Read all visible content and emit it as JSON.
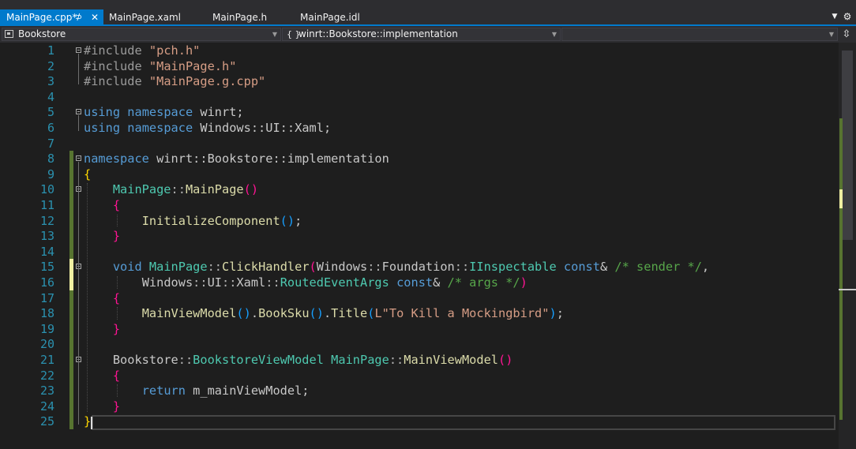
{
  "tabs": [
    {
      "label": "MainPage.cpp*",
      "active": true,
      "pinned": true,
      "closable": true
    },
    {
      "label": "MainPage.xaml",
      "active": false
    },
    {
      "label": "MainPage.h",
      "active": false
    },
    {
      "label": "MainPage.idl",
      "active": false
    }
  ],
  "tab_icons": {
    "pin": "pin-icon",
    "close": "close-icon",
    "overflow": "chevron-down-icon",
    "settings": "gear-icon"
  },
  "navigation": {
    "project": "Bookstore",
    "scope": "winrt::Bookstore::implementation",
    "member": "",
    "scope_icon": "{ }",
    "split_icon": "split-view-icon"
  },
  "colors": {
    "accent": "#007acc",
    "editor_background": "#1e1e1e",
    "line_number": "#2b91af",
    "keyword": "#569cd6",
    "string": "#d69d85",
    "comment": "#57a64a",
    "type": "#4ec9b0",
    "function": "#dcdcaa",
    "saved_change": "#577430",
    "unsaved_change": "#efefa1"
  },
  "code_lines": [
    {
      "num": "1"
    },
    {
      "num": "2"
    },
    {
      "num": "3"
    },
    {
      "num": "4"
    },
    {
      "num": "5"
    },
    {
      "num": "6"
    },
    {
      "num": "7"
    },
    {
      "num": "8"
    },
    {
      "num": "9"
    },
    {
      "num": "10"
    },
    {
      "num": "11"
    },
    {
      "num": "12"
    },
    {
      "num": "13"
    },
    {
      "num": "14"
    },
    {
      "num": "15"
    },
    {
      "num": "16"
    },
    {
      "num": "17"
    },
    {
      "num": "18"
    },
    {
      "num": "19"
    },
    {
      "num": "20"
    },
    {
      "num": "21"
    },
    {
      "num": "22"
    },
    {
      "num": "23"
    },
    {
      "num": "24"
    },
    {
      "num": "25"
    }
  ],
  "code": {
    "l1": [
      {
        "t": "#include",
        "c": "pp"
      },
      {
        "t": " ",
        "c": ""
      },
      {
        "t": "\"pch.h\"",
        "c": "str"
      }
    ],
    "l2": [
      {
        "t": "#include",
        "c": "pp"
      },
      {
        "t": " ",
        "c": ""
      },
      {
        "t": "\"MainPage.h\"",
        "c": "str"
      }
    ],
    "l3": [
      {
        "t": "#include",
        "c": "pp"
      },
      {
        "t": " ",
        "c": ""
      },
      {
        "t": "\"MainPage.g.cpp\"",
        "c": "str"
      }
    ],
    "l4": [],
    "l5": [
      {
        "t": "using",
        "c": "kw"
      },
      {
        "t": " ",
        "c": ""
      },
      {
        "t": "namespace",
        "c": "kw"
      },
      {
        "t": " winrt;",
        "c": "id"
      }
    ],
    "l6": [
      {
        "t": "using",
        "c": "kw"
      },
      {
        "t": " ",
        "c": ""
      },
      {
        "t": "namespace",
        "c": "kw"
      },
      {
        "t": " Windows::UI::Xaml;",
        "c": "id"
      }
    ],
    "l7": [],
    "l8": [
      {
        "t": "namespace",
        "c": "kw"
      },
      {
        "t": " winrt::Bookstore::implementation",
        "c": "id"
      }
    ],
    "l9": [
      {
        "t": "{",
        "c": "brc"
      }
    ],
    "l10": [
      {
        "t": "    ",
        "c": ""
      },
      {
        "t": "MainPage",
        "c": "ty"
      },
      {
        "t": "::",
        "c": "op"
      },
      {
        "t": "MainPage",
        "c": "fn"
      },
      {
        "t": "()",
        "c": "brc2"
      }
    ],
    "l11": [
      {
        "t": "    ",
        "c": ""
      },
      {
        "t": "{",
        "c": "brc2"
      }
    ],
    "l12": [
      {
        "t": "        ",
        "c": ""
      },
      {
        "t": "InitializeComponent",
        "c": "fn"
      },
      {
        "t": "()",
        "c": "br2"
      },
      {
        "t": ";",
        "c": "id"
      }
    ],
    "l13": [
      {
        "t": "    ",
        "c": ""
      },
      {
        "t": "}",
        "c": "brc2"
      }
    ],
    "l14": [],
    "l15": [
      {
        "t": "    ",
        "c": ""
      },
      {
        "t": "void",
        "c": "kw"
      },
      {
        "t": " ",
        "c": ""
      },
      {
        "t": "MainPage",
        "c": "ty"
      },
      {
        "t": "::",
        "c": "op"
      },
      {
        "t": "ClickHandler",
        "c": "fn"
      },
      {
        "t": "(",
        "c": "brc2"
      },
      {
        "t": "Windows",
        "c": "id"
      },
      {
        "t": "::",
        "c": "op"
      },
      {
        "t": "Foundation",
        "c": "id"
      },
      {
        "t": "::",
        "c": "op"
      },
      {
        "t": "IInspectable",
        "c": "ty"
      },
      {
        "t": " ",
        "c": ""
      },
      {
        "t": "const",
        "c": "kw"
      },
      {
        "t": "& ",
        "c": "id"
      },
      {
        "t": "/* sender */",
        "c": "cmt"
      },
      {
        "t": ",",
        "c": "id"
      }
    ],
    "l16": [
      {
        "t": "        ",
        "c": ""
      },
      {
        "t": "Windows",
        "c": "id"
      },
      {
        "t": "::",
        "c": "op"
      },
      {
        "t": "UI",
        "c": "id"
      },
      {
        "t": "::",
        "c": "op"
      },
      {
        "t": "Xaml",
        "c": "id"
      },
      {
        "t": "::",
        "c": "op"
      },
      {
        "t": "RoutedEventArgs",
        "c": "ty"
      },
      {
        "t": " ",
        "c": ""
      },
      {
        "t": "const",
        "c": "kw"
      },
      {
        "t": "& ",
        "c": "id"
      },
      {
        "t": "/* args */",
        "c": "cmt"
      },
      {
        "t": ")",
        "c": "brc2"
      }
    ],
    "l17": [
      {
        "t": "    ",
        "c": ""
      },
      {
        "t": "{",
        "c": "brc2"
      }
    ],
    "l18": [
      {
        "t": "        ",
        "c": ""
      },
      {
        "t": "MainViewModel",
        "c": "fn"
      },
      {
        "t": "()",
        "c": "br2"
      },
      {
        "t": ".",
        "c": "id"
      },
      {
        "t": "BookSku",
        "c": "fn"
      },
      {
        "t": "()",
        "c": "br2"
      },
      {
        "t": ".",
        "c": "id"
      },
      {
        "t": "Title",
        "c": "fn"
      },
      {
        "t": "(",
        "c": "br2"
      },
      {
        "t": "L\"To Kill a Mockingbird\"",
        "c": "str"
      },
      {
        "t": ")",
        "c": "br2"
      },
      {
        "t": ";",
        "c": "id"
      }
    ],
    "l19": [
      {
        "t": "    ",
        "c": ""
      },
      {
        "t": "}",
        "c": "brc2"
      }
    ],
    "l20": [],
    "l21": [
      {
        "t": "    ",
        "c": ""
      },
      {
        "t": "Bookstore",
        "c": "id"
      },
      {
        "t": "::",
        "c": "op"
      },
      {
        "t": "BookstoreViewModel",
        "c": "ty"
      },
      {
        "t": " ",
        "c": ""
      },
      {
        "t": "MainPage",
        "c": "ty"
      },
      {
        "t": "::",
        "c": "op"
      },
      {
        "t": "MainViewModel",
        "c": "fn"
      },
      {
        "t": "()",
        "c": "brc2"
      }
    ],
    "l22": [
      {
        "t": "    ",
        "c": ""
      },
      {
        "t": "{",
        "c": "brc2"
      }
    ],
    "l23": [
      {
        "t": "        ",
        "c": ""
      },
      {
        "t": "return",
        "c": "kw"
      },
      {
        "t": " m_mainViewModel;",
        "c": "id"
      }
    ],
    "l24": [
      {
        "t": "    ",
        "c": ""
      },
      {
        "t": "}",
        "c": "brc2"
      }
    ],
    "l25": [
      {
        "t": "}",
        "c": "brc"
      }
    ]
  }
}
